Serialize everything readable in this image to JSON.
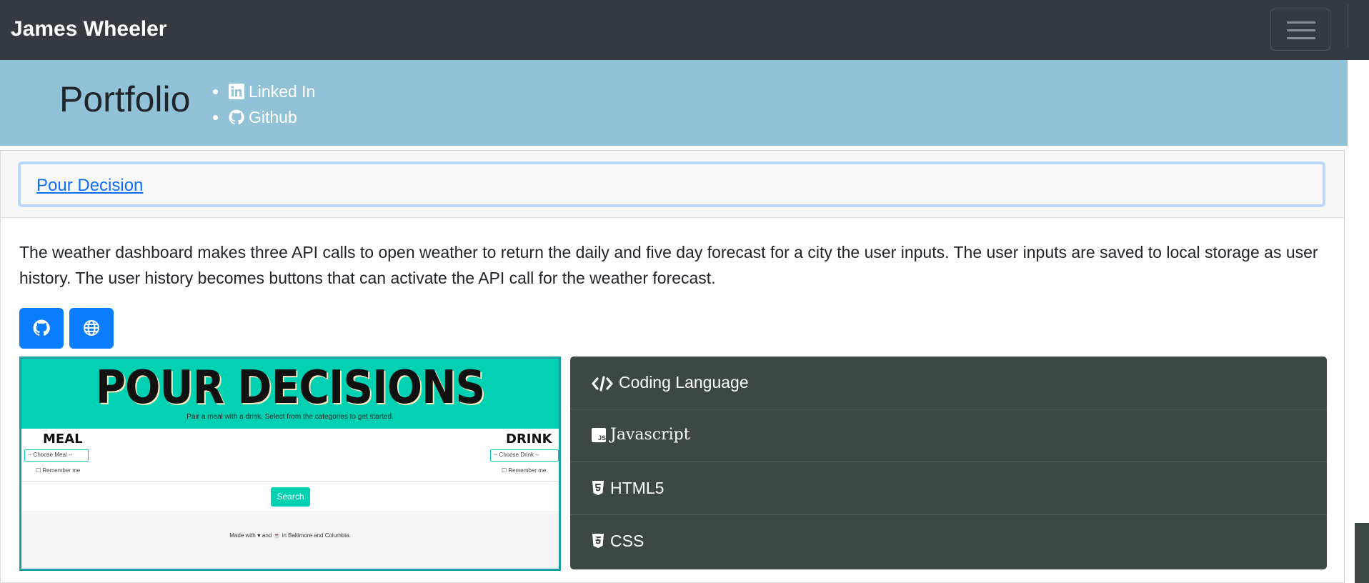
{
  "navbar": {
    "brand": "James Wheeler",
    "toggler_icon": "hamburger-icon"
  },
  "hero": {
    "title": "Portfolio",
    "links": [
      {
        "label": "Linked In",
        "icon": "linkedin-icon"
      },
      {
        "label": "Github",
        "icon": "github-icon"
      }
    ]
  },
  "project": {
    "title": "Pour Decision",
    "description": "The weather dashboard makes three API calls to open weather to return the daily and five day forecast for a city the user inputs. The user inputs are saved to local storage as user history. The user history becomes buttons that can activate the API call for the weather forecast.",
    "buttons": [
      {
        "icon": "github-icon"
      },
      {
        "icon": "globe-icon"
      }
    ],
    "screenshot": {
      "title": "POUR DECISIONS",
      "subtitle": "Pair a meal with a drink. Select from the categories to get started.",
      "meal_label": "MEAL",
      "drink_label": "DRINK",
      "meal_select": "-- Choose Meal --",
      "drink_select": "-- Choose Drink --",
      "remember": "Remember me",
      "search_label": "Search",
      "footer": "Made with ♥ and ☕ in Baltimore and Columbia."
    },
    "languages": [
      {
        "label": "Coding Language",
        "icon": "code-icon"
      },
      {
        "label": "Javascript",
        "icon": "js-icon"
      },
      {
        "label": "HTML5",
        "icon": "html5-icon"
      },
      {
        "label": "CSS",
        "icon": "css3-icon"
      }
    ]
  },
  "colors": {
    "navbar": "#343a40",
    "hero": "#92c2d8",
    "primary": "#0a7cff",
    "languages_panel": "#3d4845",
    "screenshot_accent": "#00d1b2"
  }
}
